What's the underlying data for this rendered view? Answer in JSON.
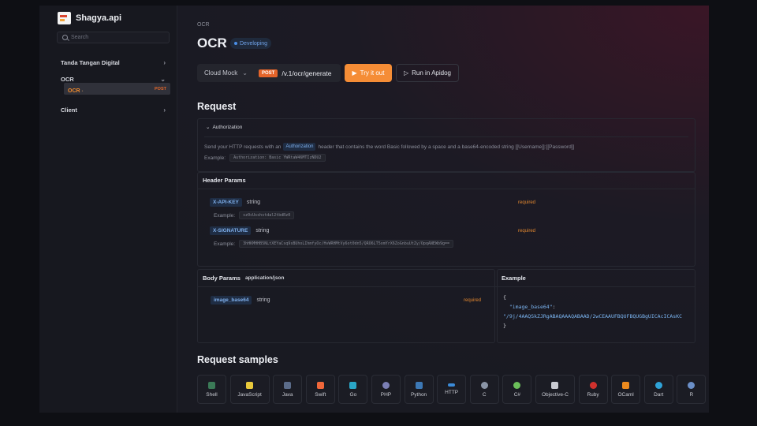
{
  "brand": {
    "name": "Shagya.api"
  },
  "sidebar": {
    "search_placeholder": "Search",
    "items": [
      {
        "label": "Tanda Tangan Digital",
        "chevron": "›"
      },
      {
        "label": "OCR",
        "chevron": "⌄"
      },
      {
        "label": "Client",
        "chevron": "›"
      }
    ],
    "sub_item": {
      "label": "OCR",
      "dot": "•",
      "method": "POST"
    }
  },
  "page": {
    "breadcrumb": "OCR",
    "title": "OCR",
    "status": "Developing"
  },
  "request_bar": {
    "env": "Cloud Mock",
    "method": "POST",
    "url": "/v.1/ocr/generate",
    "try_label": "Try it out",
    "run_label": "Run in Apidog"
  },
  "request": {
    "heading": "Request",
    "auth": {
      "heading": "Authorization",
      "text_before": "Send your HTTP requests with an",
      "badge": "Authorization",
      "text_after": "header that contains the word Basic followed by a space and a base64-encoded string [[Username]]:[[Password]]",
      "example_label": "Example:",
      "example_value": "Authorization: Basic YWRtaW46MTIzNDU2"
    },
    "header_params": {
      "heading": "Header Params",
      "params": [
        {
          "name": "X-API-KEY",
          "type": "string",
          "required": "required",
          "example_label": "Example:",
          "example": "sz0cUsshstdal2tbdRz0"
        },
        {
          "name": "X-SIGNATURE",
          "type": "string",
          "required": "required",
          "example_label": "Example:",
          "example": "3hHKMHHB5NLtXEYaCsq9sBUhoLIhmfyOc/HvWRHMtVy6ot0dn5/QRO6LT5omYrX6ZoGnbuUtZy/OpqANEWb9g=="
        }
      ]
    },
    "body_params": {
      "heading": "Body Params",
      "content_type": "application/json",
      "params": [
        {
          "name": "image_base64",
          "type": "string",
          "required": "required"
        }
      ]
    },
    "example": {
      "heading": "Example",
      "open": "{",
      "key": "\"image_base64\"",
      "colon": ":",
      "value": "\"/9j/4AAQSkZJRgABAQAAAQABAAD/2wCEAAUFBQUFBQUGBgUICAcICAsKC",
      "close": "}"
    }
  },
  "samples": {
    "heading": "Request samples",
    "items": [
      {
        "label": "Shell",
        "icon": "shell-icon",
        "color": "#3b7a57"
      },
      {
        "label": "JavaScript",
        "icon": "javascript-icon",
        "color": "#e9c93b"
      },
      {
        "label": "Java",
        "icon": "java-icon",
        "color": "#5b6c8a"
      },
      {
        "label": "Swift",
        "icon": "swift-icon",
        "color": "#f0673a"
      },
      {
        "label": "Go",
        "icon": "go-icon",
        "color": "#2aa6c7"
      },
      {
        "label": "PHP",
        "icon": "php-icon",
        "color": "#7b7fb5"
      },
      {
        "label": "Python",
        "icon": "python-icon",
        "color": "#3c78b5"
      },
      {
        "label": "HTTP",
        "icon": "http-icon",
        "color": "#3b8bd8"
      },
      {
        "label": "C",
        "icon": "c-icon",
        "color": "#8a94a6"
      },
      {
        "label": "C#",
        "icon": "csharp-icon",
        "color": "#6bbf5a"
      },
      {
        "label": "Objective-C",
        "icon": "objective-c-icon",
        "color": "#c8cad2"
      },
      {
        "label": "Ruby",
        "icon": "ruby-icon",
        "color": "#d0312d"
      },
      {
        "label": "OCaml",
        "icon": "ocaml-icon",
        "color": "#ec8a1e"
      },
      {
        "label": "Dart",
        "icon": "dart-icon",
        "color": "#2fa3d8"
      },
      {
        "label": "R",
        "icon": "r-icon",
        "color": "#6b8fc8"
      }
    ]
  }
}
